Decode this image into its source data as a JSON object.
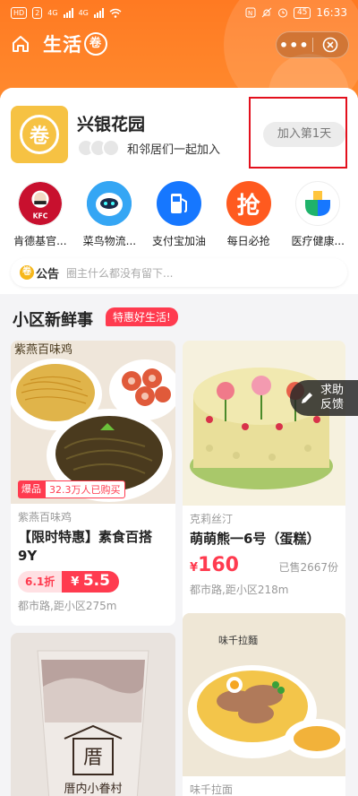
{
  "status_bar": {
    "left_badges": [
      "HD",
      "2"
    ],
    "network": "4G",
    "time": "16:33",
    "battery": "45"
  },
  "nav": {
    "brand_text": "生活",
    "brand_seal": "卷"
  },
  "community": {
    "logo_char": "卷",
    "name": "兴银花园",
    "neighbors_text": "和邻居们一起加入",
    "join_label": "加入第1天"
  },
  "shortcuts": [
    {
      "label": "肯德基官...",
      "icon": "kfc-icon",
      "color": "#ffffff"
    },
    {
      "label": "菜鸟物流...",
      "icon": "cainiao-robot-icon",
      "color": "#2a9cf2"
    },
    {
      "label": "支付宝加油",
      "icon": "fuel-pump-icon",
      "color": "#1677ff"
    },
    {
      "label": "每日必抢",
      "icon": "grab-icon",
      "color": "#ff5a1f"
    },
    {
      "label": "医疗健康...",
      "icon": "medical-icon",
      "color": "#ffffff"
    }
  ],
  "notice": {
    "tag": "公告",
    "tag_seal": "卷",
    "text": "圈主什么都没有留下..."
  },
  "section": {
    "title": "小区新鲜事",
    "badge": "特惠好生活!"
  },
  "products": [
    {
      "brand": "紫燕百味鸡",
      "title": "【限时特惠】素食百搭9Y",
      "hot_tag": "爆品",
      "hot_count": "32.3万人已购买",
      "discount": "6.1折",
      "price_symbol": "¥",
      "price": "5.5",
      "location": "都市路,距小区275m",
      "img_caption": "紫燕百味鸡"
    },
    {
      "brand": "克莉丝汀",
      "title": "萌萌熊一6号（蛋糕）",
      "price_symbol": "¥",
      "price": "160",
      "sold": "已售2667份",
      "location": "都市路,距小区218m"
    },
    {
      "shop_sign": "厝内小眷村"
    },
    {
      "brand": "味千拉面",
      "img_caption": "味千拉麵"
    }
  ],
  "feedback": {
    "label": "求助反馈"
  }
}
